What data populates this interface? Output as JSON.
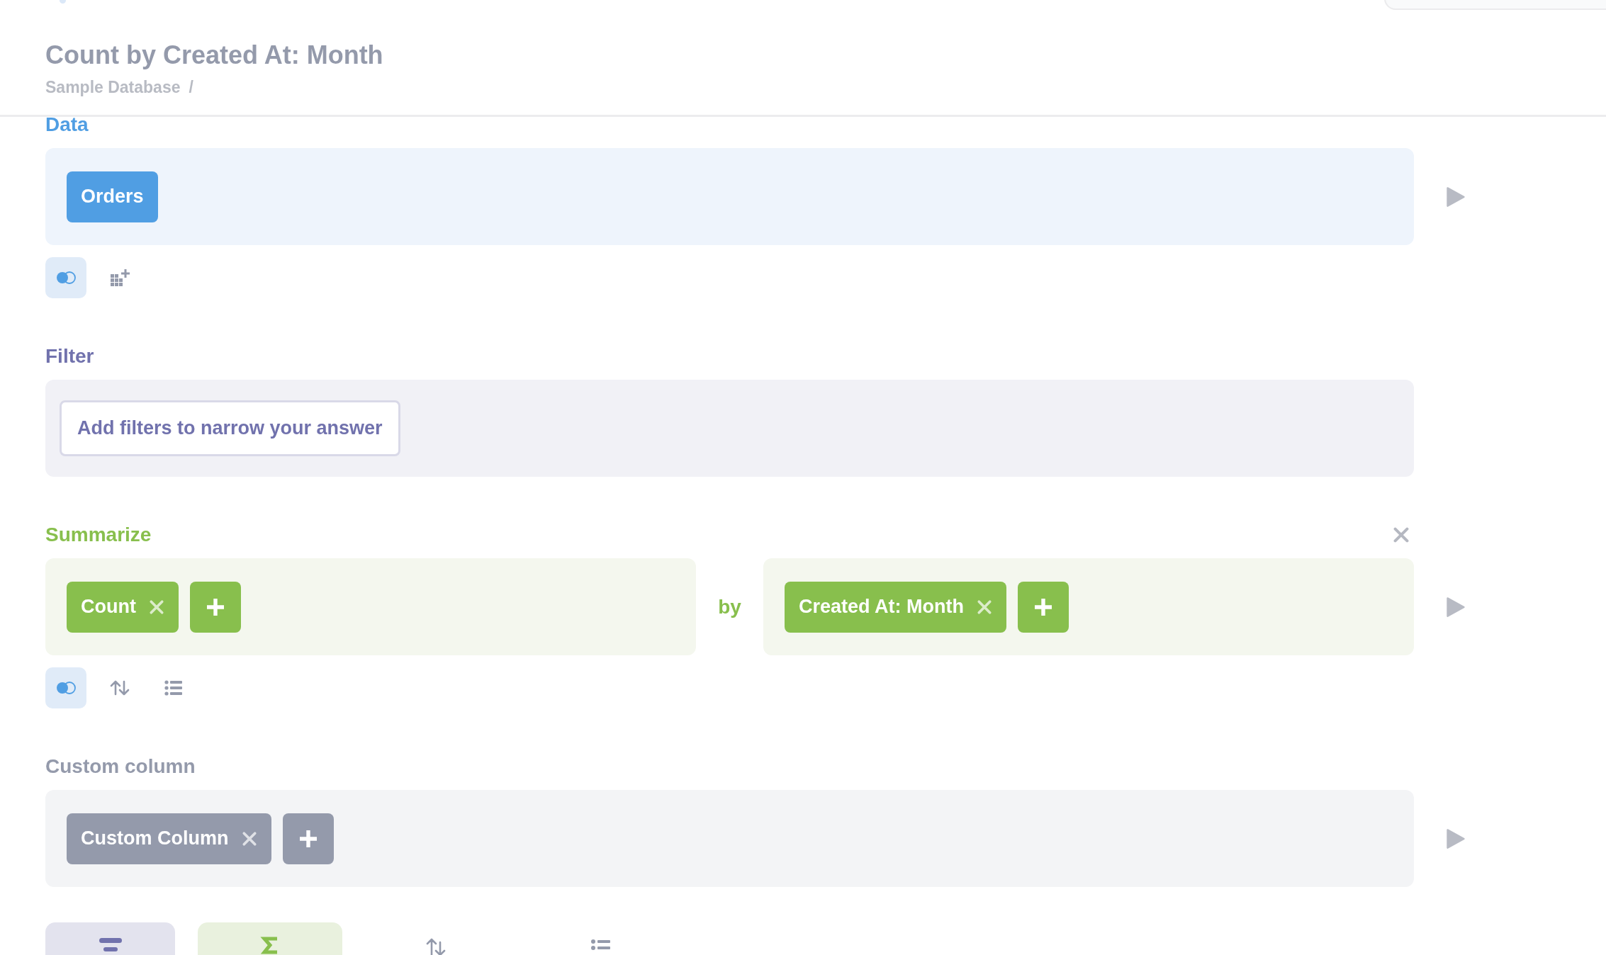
{
  "header": {
    "title": "Count by Created At: Month",
    "breadcrumb": "Sample Database",
    "separator": "/"
  },
  "steps": [
    {
      "kind": "data",
      "label": "Data",
      "closable": false,
      "preview": true,
      "groups": [
        {
          "items": [
            {
              "label": "Orders",
              "removable": false
            }
          ],
          "add": false
        }
      ],
      "actions": [
        {
          "kind": "join"
        },
        {
          "kind": "custom-column"
        }
      ]
    },
    {
      "kind": "filter",
      "label": "Filter",
      "closable": false,
      "preview": false,
      "placeholder": "Add filters to narrow your answer"
    },
    {
      "kind": "summarize",
      "label": "Summarize",
      "closable": true,
      "preview": true,
      "connector": "by",
      "groups": [
        {
          "items": [
            {
              "label": "Count",
              "removable": true
            }
          ],
          "add": true
        },
        {
          "items": [
            {
              "label": "Created At: Month",
              "removable": true
            }
          ],
          "add": true
        }
      ],
      "actions": [
        {
          "kind": "join"
        },
        {
          "kind": "sort"
        },
        {
          "kind": "limit"
        }
      ]
    },
    {
      "kind": "custom",
      "label": "Custom column",
      "closable": false,
      "preview": true,
      "groups": [
        {
          "items": [
            {
              "label": "Custom Column",
              "removable": true
            }
          ],
          "add": true
        }
      ]
    }
  ],
  "next_steps": [
    {
      "kind": "filter"
    },
    {
      "kind": "summarize"
    },
    {
      "kind": "sort"
    },
    {
      "kind": "limit"
    }
  ]
}
